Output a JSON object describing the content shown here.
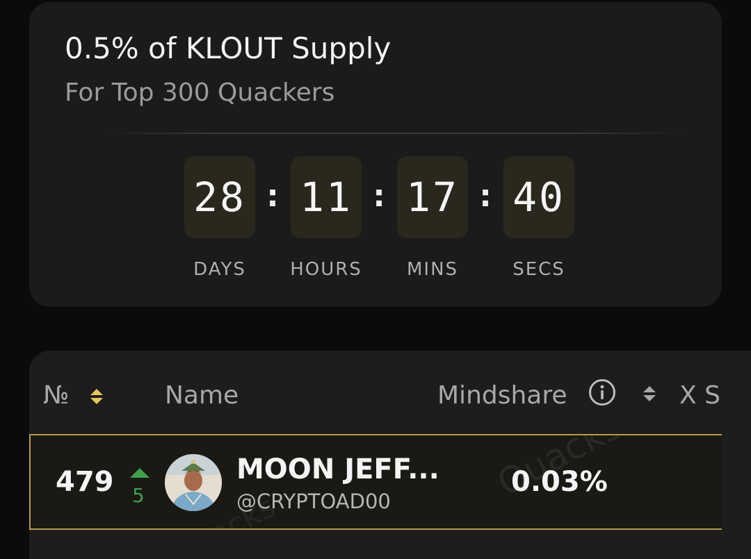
{
  "countdown": {
    "title": "0.5% of KLOUT Supply",
    "subtitle": "For Top 300 Quackers",
    "separator": ":",
    "units": [
      {
        "value": "28",
        "label": "DAYS"
      },
      {
        "value": "11",
        "label": "HOURS"
      },
      {
        "value": "17",
        "label": "MINS"
      },
      {
        "value": "40",
        "label": "SECS"
      }
    ]
  },
  "leaderboard": {
    "columns": {
      "rank": "№",
      "name": "Name",
      "mindshare": "Mindshare",
      "x_score": "X S"
    },
    "rows": [
      {
        "rank": "479",
        "rank_change": "5",
        "rank_trend": "up",
        "name": "MOON JEFF...",
        "handle": "@CRYPTOAD00",
        "mindshare": "0.03%"
      }
    ],
    "watermark": "Quacks"
  },
  "colors": {
    "background": "#0b0b0b",
    "card": "#1b1b1b",
    "timer_box": "#2a271d",
    "sort_icon_up": "#e8c65a",
    "rank_up": "#3ea04a",
    "highlight_border": "#b59d45"
  },
  "icons": {
    "sort": "sort-icon",
    "info": "info-icon",
    "rank_up": "triangle-up-icon",
    "avatar": "avatar-image"
  }
}
